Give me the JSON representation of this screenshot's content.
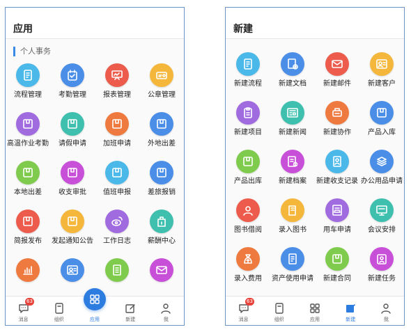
{
  "left": {
    "title": "应用",
    "section": "个人事务",
    "items": [
      {
        "label": "流程管理",
        "color": "#4ab8e8",
        "icon": "flow-doc-icon"
      },
      {
        "label": "考勤管理",
        "color": "#4a8ee8",
        "icon": "attendance-check-icon"
      },
      {
        "label": "报表管理",
        "color": "#ec5b4b",
        "icon": "report-board-icon"
      },
      {
        "label": "公章管理",
        "color": "#f5b73b",
        "icon": "seal-icon"
      },
      {
        "label": "高温作业考勤",
        "color": "#a16be0",
        "icon": "box-icon"
      },
      {
        "label": "请假申请",
        "color": "#3fbfae",
        "icon": "box-icon"
      },
      {
        "label": "加班申请",
        "color": "#ef7a3f",
        "icon": "box-icon"
      },
      {
        "label": "外地出差",
        "color": "#4a8ee8",
        "icon": "box-icon"
      },
      {
        "label": "本地出差",
        "color": "#7fcb4d",
        "icon": "box-icon"
      },
      {
        "label": "收支审批",
        "color": "#c84fd8",
        "icon": "box-icon"
      },
      {
        "label": "值班申报",
        "color": "#4ab8e8",
        "icon": "box-icon"
      },
      {
        "label": "差旅报销",
        "color": "#4a8ee8",
        "icon": "box-icon"
      },
      {
        "label": "简报发布",
        "color": "#ec5b4b",
        "icon": "box-icon"
      },
      {
        "label": "发起通知公告",
        "color": "#f5b73b",
        "icon": "box-icon"
      },
      {
        "label": "工作日志",
        "color": "#a16be0",
        "icon": "weibo-eye-icon"
      },
      {
        "label": "薪酬中心",
        "color": "#3fbfae",
        "icon": "wallet-icon"
      },
      {
        "label": "",
        "color": "#ef7a3f",
        "icon": "bar-chart-icon"
      },
      {
        "label": "",
        "color": "#4a8ee8",
        "icon": "contact-card-icon"
      },
      {
        "label": "",
        "color": "#7fcb4d",
        "icon": "document-icon"
      },
      {
        "label": "",
        "color": "#c84fd8",
        "icon": "mail-icon"
      }
    ],
    "tabs": [
      {
        "label": "消息",
        "icon": "message-icon",
        "badge": "63"
      },
      {
        "label": "组织",
        "icon": "organization-icon"
      },
      {
        "label": "应用",
        "icon": "apps-grid-icon",
        "active": true
      },
      {
        "label": "新建",
        "icon": "new-edit-icon"
      },
      {
        "label": "我",
        "icon": "person-icon"
      }
    ]
  },
  "right": {
    "title": "新建",
    "items": [
      {
        "label": "新建流程",
        "color": "#4ab8e8",
        "icon": "flow-doc-icon"
      },
      {
        "label": "新建文档",
        "color": "#4a8ee8",
        "icon": "document-add-icon"
      },
      {
        "label": "新建邮件",
        "color": "#ec5b4b",
        "icon": "mail-icon"
      },
      {
        "label": "新建客户",
        "color": "#f5b73b",
        "icon": "contact-card-icon"
      },
      {
        "label": "新建项目",
        "color": "#a16be0",
        "icon": "clipboard-icon"
      },
      {
        "label": "新建新闻",
        "color": "#3fbfae",
        "icon": "news-icon"
      },
      {
        "label": "新建协作",
        "color": "#ef7a3f",
        "icon": "collab-icon"
      },
      {
        "label": "产品入库",
        "color": "#4a8ee8",
        "icon": "box-icon"
      },
      {
        "label": "产品出库",
        "color": "#7fcb4d",
        "icon": "box-icon"
      },
      {
        "label": "新建档案",
        "color": "#c84fd8",
        "icon": "archive-icon"
      },
      {
        "label": "新建收支记录",
        "color": "#4ab8e8",
        "icon": "person-doc-icon"
      },
      {
        "label": "办公用品申请",
        "color": "#4a8ee8",
        "icon": "stack-icon"
      },
      {
        "label": "图书借阅",
        "color": "#ec5b4b",
        "icon": "reader-icon"
      },
      {
        "label": "录入图书",
        "color": "#f5b73b",
        "icon": "book-icon"
      },
      {
        "label": "用车申请",
        "color": "#a16be0",
        "icon": "car-doc-icon"
      },
      {
        "label": "会议安排",
        "color": "#3fbfae",
        "icon": "meeting-icon"
      },
      {
        "label": "录入费用",
        "color": "#ef7a3f",
        "icon": "money-bag-icon"
      },
      {
        "label": "资产使用申请",
        "color": "#4a8ee8",
        "icon": "asset-doc-icon"
      },
      {
        "label": "新建合同",
        "color": "#7fcb4d",
        "icon": "box-icon"
      },
      {
        "label": "新建任务",
        "color": "#c84fd8",
        "icon": "task-person-icon"
      }
    ],
    "tabs": [
      {
        "label": "消息",
        "icon": "message-icon",
        "badge": "63"
      },
      {
        "label": "组织",
        "icon": "organization-icon"
      },
      {
        "label": "应用",
        "icon": "apps-grid-icon"
      },
      {
        "label": "新建",
        "icon": "new-edit-icon",
        "active": true
      },
      {
        "label": "我",
        "icon": "person-icon"
      }
    ]
  }
}
